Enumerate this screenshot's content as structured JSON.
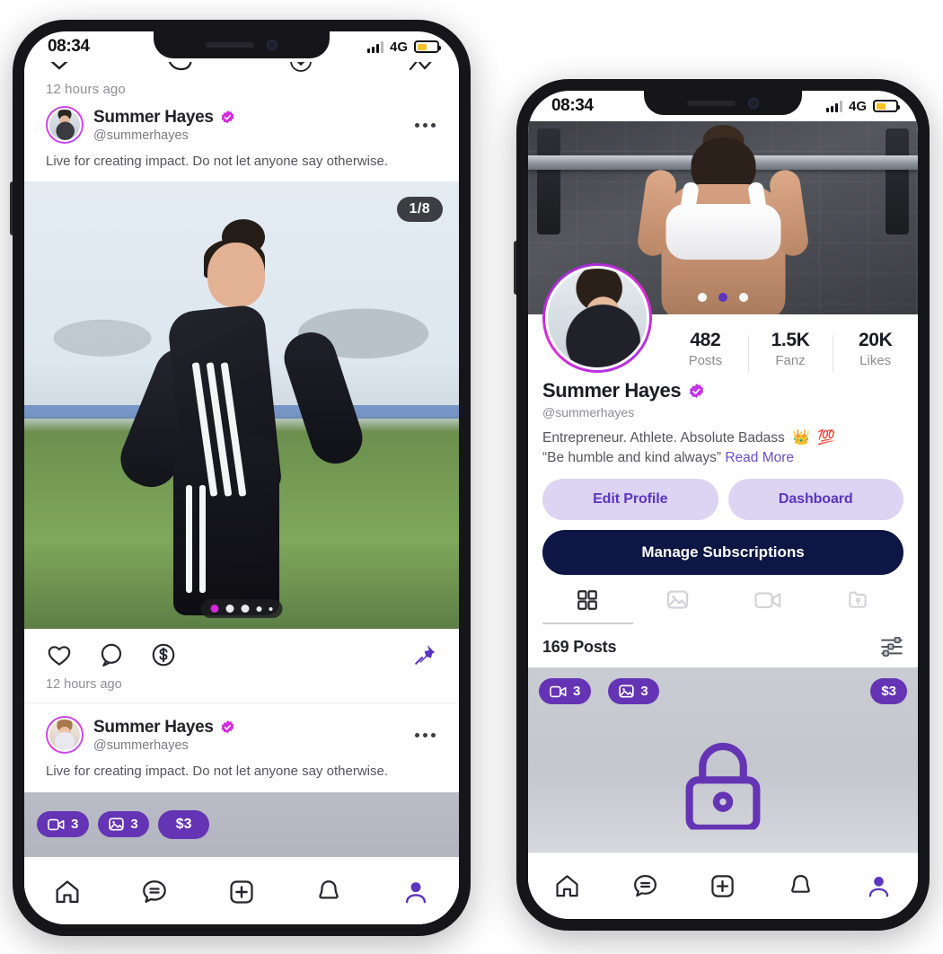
{
  "brand": {
    "purple": "#6434b4",
    "purple_dark": "#5b35c0",
    "navy": "#0d1644",
    "magenta": "#cf2ad6",
    "soft_lilac": "#dcd4f2"
  },
  "status_bar": {
    "time": "08:34",
    "network": "4G",
    "signal_icon": "signal-bars-icon",
    "battery_icon": "battery-icon"
  },
  "feed_screen": {
    "top_timestamp": "12 hours ago",
    "posts": [
      {
        "display_name": "Summer Hayes",
        "handle": "@summerhayes",
        "verified_icon": "verified-badge-icon",
        "caption": "Live for creating impact. Do not let anyone say otherwise.",
        "more_icon": "more-options-icon",
        "media_counter": "1/8",
        "carousel_dots": 5,
        "carousel_active_index": 0,
        "actions": {
          "like_icon": "heart-icon",
          "comment_icon": "comment-icon",
          "tip_icon": "dollar-circle-icon",
          "pin_icon": "pin-icon"
        },
        "timestamp": "12 hours ago"
      },
      {
        "display_name": "Summer Hayes",
        "handle": "@summerhayes",
        "verified_icon": "verified-badge-icon",
        "caption": "Live for creating impact. Do not let anyone say otherwise.",
        "more_icon": "more-options-icon",
        "locked_media": {
          "video_icon": "video-camera-icon",
          "video_count": "3",
          "photo_icon": "photo-icon",
          "photo_count": "3",
          "price": "$3"
        }
      }
    ]
  },
  "profile_screen": {
    "cover_dots": 3,
    "cover_active_index": 1,
    "avatar_icon": "profile-avatar",
    "stats": [
      {
        "value": "482",
        "label": "Posts"
      },
      {
        "value": "1.5K",
        "label": "Fanz"
      },
      {
        "value": "20K",
        "label": "Likes"
      }
    ],
    "display_name": "Summer Hayes",
    "verified_icon": "verified-badge-icon",
    "handle": "@summerhayes",
    "bio_line": "Entrepreneur. Athlete. Absolute Badass",
    "bio_emoji_1": "👑",
    "bio_emoji_2": "💯",
    "quote": "“Be humble and kind always”",
    "read_more": "Read More",
    "buttons": {
      "edit_profile": "Edit Profile",
      "dashboard": "Dashboard",
      "manage_subscriptions": "Manage Subscriptions"
    },
    "tabs": [
      {
        "icon": "grid-icon",
        "active": true
      },
      {
        "icon": "photo-icon",
        "active": false
      },
      {
        "icon": "video-camera-icon",
        "active": false
      },
      {
        "icon": "locked-folder-icon",
        "active": false
      }
    ],
    "posts_count": "169 Posts",
    "filter_icon": "filter-sliders-icon",
    "grid_item": {
      "video_icon": "video-camera-icon",
      "video_count": "3",
      "photo_icon": "photo-icon",
      "photo_count": "3",
      "price": "$3",
      "lock_icon": "lock-icon"
    }
  },
  "bottom_nav": {
    "items": [
      {
        "icon": "home-icon",
        "active": false
      },
      {
        "icon": "chat-icon",
        "active": false
      },
      {
        "icon": "add-post-icon",
        "active": false
      },
      {
        "icon": "bell-icon",
        "active": false
      },
      {
        "icon": "profile-icon",
        "active": true
      }
    ]
  }
}
